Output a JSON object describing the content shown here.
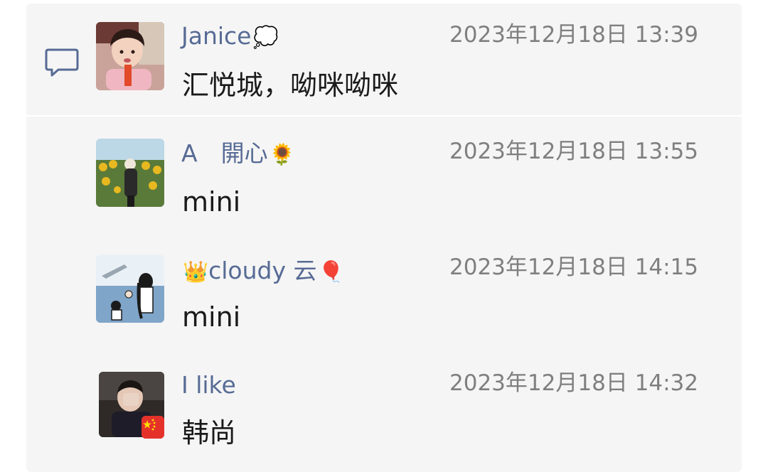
{
  "comments": [
    {
      "name": "Janice",
      "name_emoji": "💭",
      "time": "2023年12月18日 13:39",
      "message": "汇悦城，呦咪呦咪",
      "avatar_icon": "child-avatar"
    },
    {
      "name": "A　開心",
      "name_emoji": "🌻",
      "time": "2023年12月18日 13:55",
      "message": "mini",
      "avatar_icon": "sunflower-field-avatar"
    },
    {
      "name_prefix_emoji": "👑",
      "name": "cloudy 云",
      "name_emoji": "🎈",
      "time": "2023年12月18日 14:15",
      "message": "mini",
      "avatar_icon": "seaside-illustration-avatar"
    },
    {
      "name": "I like",
      "name_emoji": "",
      "time": "2023年12月18日 14:32",
      "message": "韩尚",
      "avatar_icon": "person-avatar",
      "badge_icon": "china-flag-icon"
    }
  ],
  "colors": {
    "name": "#576b95",
    "time": "#7f7f7f",
    "message": "#1a1a1a",
    "panel": "#f5f5f5"
  }
}
